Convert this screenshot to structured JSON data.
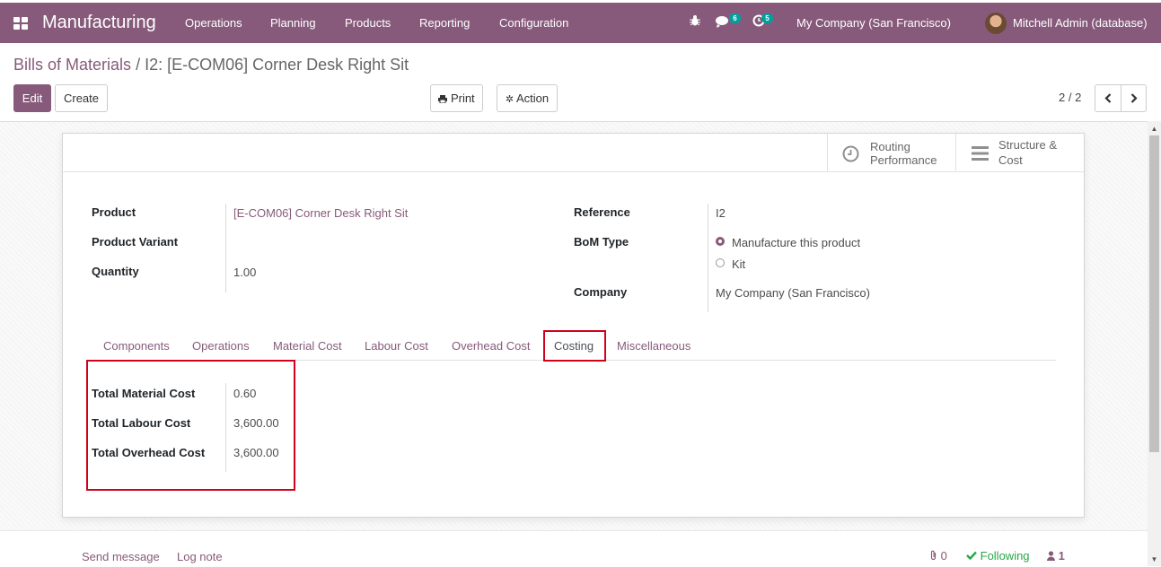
{
  "navbar": {
    "app_name": "Manufacturing",
    "menu": [
      "Operations",
      "Planning",
      "Products",
      "Reporting",
      "Configuration"
    ],
    "messages_count": "6",
    "activities_count": "5",
    "company": "My Company (San Francisco)",
    "user": "Mitchell Admin (database)"
  },
  "breadcrumb": {
    "parent": "Bills of Materials",
    "separator": "/",
    "current": "I2: [E-COM06] Corner Desk Right Sit"
  },
  "toolbar": {
    "edit": "Edit",
    "create": "Create",
    "print": "Print",
    "action": "Action",
    "pager": "2 / 2"
  },
  "smart_buttons": {
    "routing_line1": "Routing",
    "routing_line2": "Performance",
    "structure_line1": "Structure &",
    "structure_line2": "Cost"
  },
  "form": {
    "product_label": "Product",
    "product_value": "[E-COM06] Corner Desk Right Sit",
    "variant_label": "Product Variant",
    "variant_value": "",
    "quantity_label": "Quantity",
    "quantity_value": "1.00",
    "reference_label": "Reference",
    "reference_value": "I2",
    "bom_type_label": "BoM Type",
    "bom_type_options": [
      "Manufacture this product",
      "Kit"
    ],
    "bom_type_selected": "Manufacture this product",
    "company_label": "Company",
    "company_value": "My Company (San Francisco)"
  },
  "tabs": [
    "Components",
    "Operations",
    "Material Cost",
    "Labour Cost",
    "Overhead Cost",
    "Costing",
    "Miscellaneous"
  ],
  "active_tab": "Costing",
  "costing": {
    "material_label": "Total Material Cost",
    "material_value": "0.60",
    "labour_label": "Total Labour Cost",
    "labour_value": "3,600.00",
    "overhead_label": "Total Overhead Cost",
    "overhead_value": "3,600.00"
  },
  "chatter": {
    "send_message": "Send message",
    "log_note": "Log note",
    "attachments": "0",
    "following": "Following",
    "followers": "1"
  },
  "colors": {
    "brand": "#875a7b",
    "highlight": "#d0021b",
    "badge": "#00a09d",
    "following": "#28a745"
  }
}
